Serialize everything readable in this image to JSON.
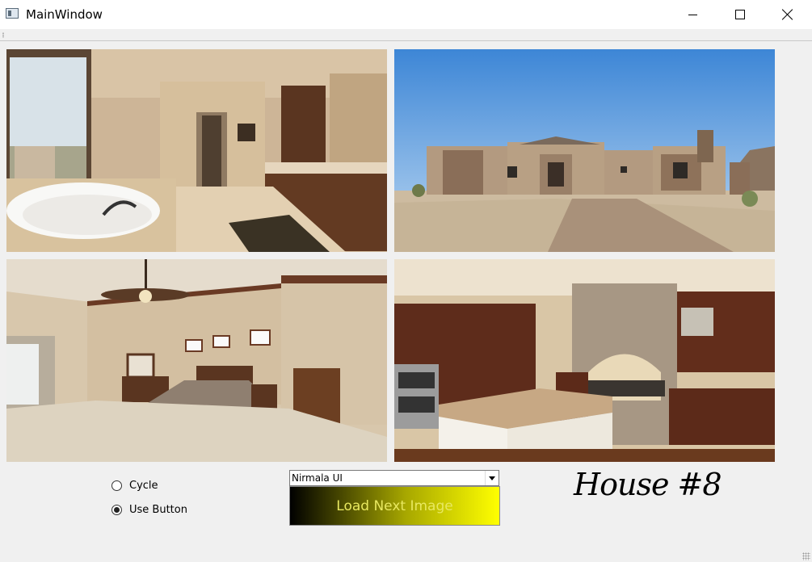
{
  "window": {
    "title": "MainWindow"
  },
  "photos": [
    {
      "subject": "bathroom"
    },
    {
      "subject": "house-exterior"
    },
    {
      "subject": "bedroom"
    },
    {
      "subject": "kitchen"
    }
  ],
  "controls": {
    "radio_cycle": {
      "label": "Cycle",
      "checked": false
    },
    "radio_use_button": {
      "label": "Use Button",
      "checked": true
    },
    "font_select": {
      "value": "Nirmala UI"
    },
    "load_button": {
      "label": "Load Next Image"
    },
    "house_label": "House #8"
  },
  "colors": {
    "button_gradient_start": "#000000",
    "button_gradient_end": "#ffff00",
    "button_text": "#e8e860"
  }
}
